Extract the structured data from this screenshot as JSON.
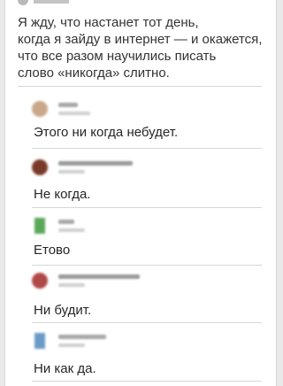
{
  "post": {
    "lines": [
      "Я жду, что настанет тот день,",
      "когда я зайду в интернет — и окажется,",
      "что все разом научились писать",
      "слово «никогда» слитно."
    ]
  },
  "comments": [
    {
      "text": "Этого ни когда небудет.",
      "avatar_color": "#c9a88a"
    },
    {
      "text": "Не когда.",
      "avatar_color": "#7a3a2a"
    },
    {
      "text": "Етово",
      "avatar_color": "#5aa85a"
    },
    {
      "text": "Ни будит.",
      "avatar_color": "#b04848"
    },
    {
      "text": "Ни как да.",
      "avatar_color": "#6a9ac8"
    }
  ]
}
